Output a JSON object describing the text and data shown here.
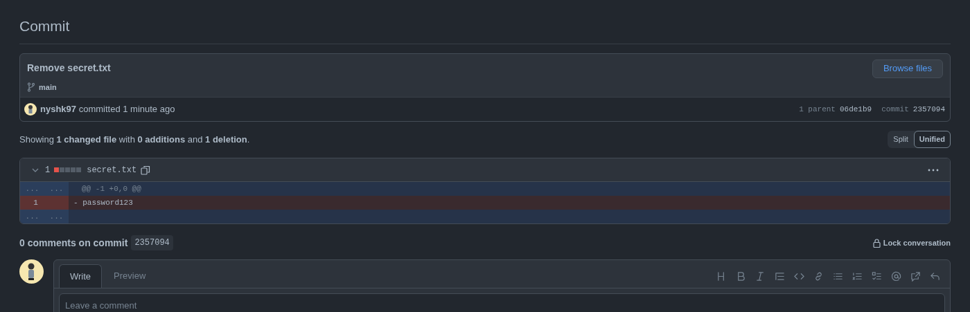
{
  "page_title": "Commit",
  "commit": {
    "message": "Remove secret.txt",
    "branch": "main",
    "browse_button": "Browse files",
    "author": "nyshk97",
    "committed_text": "committed 1 minute ago",
    "parent_label": "1 parent",
    "parent_sha": "06de1b9",
    "commit_label": "commit",
    "commit_sha": "2357094"
  },
  "summary": "Showing **1 changed file** with **0 additions** and **1 deletion**.",
  "view_modes": [
    {
      "label": "Split",
      "selected": false
    },
    {
      "label": "Unified",
      "selected": true
    }
  ],
  "file": {
    "expanded": true,
    "changes": "1",
    "diffstat": [
      {
        "kind": "deleted"
      },
      {
        "kind": "neutral"
      },
      {
        "kind": "neutral"
      },
      {
        "kind": "neutral"
      },
      {
        "kind": "neutral"
      }
    ],
    "name": "secret.txt",
    "lines": [
      {
        "kind": "hunk",
        "old_num": "...",
        "new_num": "...",
        "content": "@@ -1 +0,0 @@"
      },
      {
        "kind": "deletion",
        "old_num": "1",
        "content": "- password123"
      },
      {
        "kind": "expander",
        "old_num": "...",
        "new_num": "..."
      }
    ]
  },
  "comments": {
    "heading": "0 comments on commit",
    "sha": "2357094",
    "lock_button": "Lock conversation",
    "tabs": [
      {
        "label": "Write",
        "selected": true
      },
      {
        "label": "Preview",
        "selected": false
      }
    ],
    "placeholder": "Leave a comment"
  }
}
